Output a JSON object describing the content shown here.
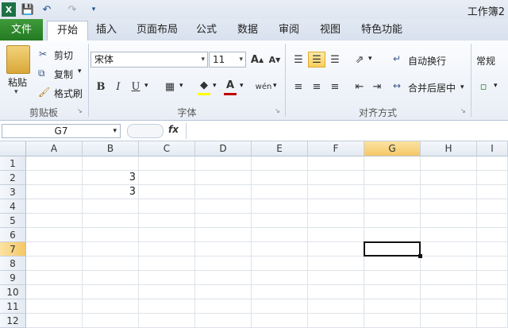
{
  "window": {
    "title": "工作簿2"
  },
  "quick_access": {
    "save_icon": "save-icon",
    "undo_icon": "undo-icon",
    "redo_icon": "redo-icon",
    "customize_icon": "customize-icon"
  },
  "tabs": [
    {
      "label": "文件"
    },
    {
      "label": "开始"
    },
    {
      "label": "插入"
    },
    {
      "label": "页面布局"
    },
    {
      "label": "公式"
    },
    {
      "label": "数据"
    },
    {
      "label": "审阅"
    },
    {
      "label": "视图"
    },
    {
      "label": "特色功能"
    }
  ],
  "clipboard": {
    "paste": "粘贴",
    "cut": "剪切",
    "copy": "复制",
    "format_painter": "格式刷",
    "group": "剪贴板"
  },
  "font": {
    "name": "宋体",
    "size": "11",
    "bold": "B",
    "italic": "I",
    "underline": "U",
    "color_glyph": "A",
    "grow": "A",
    "shrink": "A",
    "phonetic": "wén",
    "group": "字体",
    "font_color": "#c00000",
    "fill_color": "#ffff00"
  },
  "alignment": {
    "wrap": "自动换行",
    "merge": "合并后居中",
    "group": "对齐方式"
  },
  "number": {
    "format": "常规"
  },
  "formula_bar": {
    "name_box": "G7",
    "fx": "fx",
    "content": ""
  },
  "grid": {
    "columns": [
      "A",
      "B",
      "C",
      "D",
      "E",
      "F",
      "G",
      "H",
      "I"
    ],
    "rows": [
      "1",
      "2",
      "3",
      "4",
      "5",
      "6",
      "7",
      "8",
      "9",
      "10",
      "11",
      "12"
    ],
    "active_column": "G",
    "active_row": "7",
    "cells": [
      {
        "ref": "B2",
        "value": "3"
      },
      {
        "ref": "B3",
        "value": "3"
      }
    ]
  }
}
